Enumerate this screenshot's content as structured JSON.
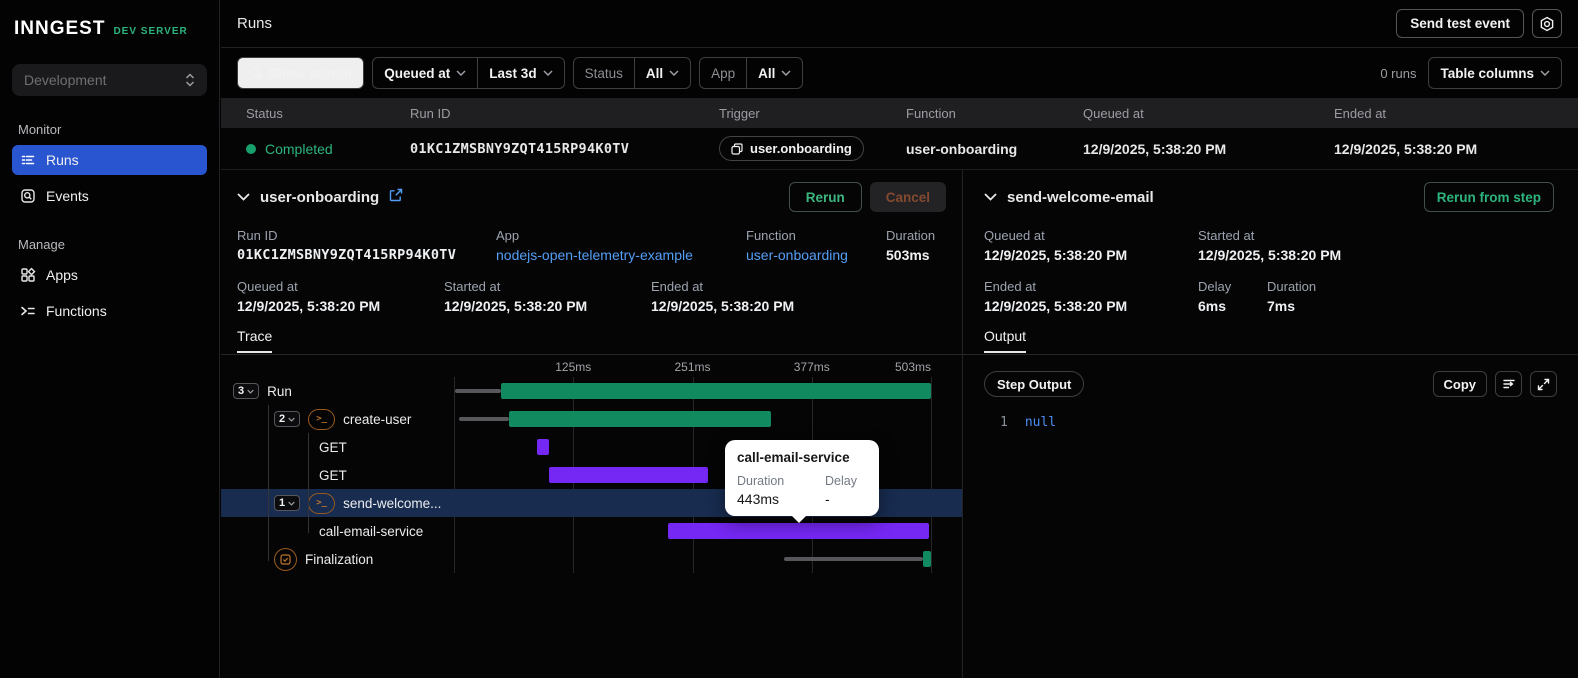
{
  "app": {
    "logo": "INNGEST",
    "env_badge": "DEV SERVER"
  },
  "sidebar": {
    "environment": "Development",
    "monitor_label": "Monitor",
    "manage_label": "Manage",
    "items": {
      "runs": "Runs",
      "events": "Events",
      "apps": "Apps",
      "functions": "Functions"
    }
  },
  "header": {
    "title": "Runs",
    "send_test_event": "Send test event"
  },
  "filters": {
    "show_search": "Show search",
    "time_field": "Queued at",
    "time_range": "Last 3d",
    "status_label": "Status",
    "status_value": "All",
    "app_label": "App",
    "app_value": "All",
    "runs_count": "0 runs",
    "table_columns": "Table columns"
  },
  "runs_table": {
    "columns": [
      "Status",
      "Run ID",
      "Trigger",
      "Function",
      "Queued at",
      "Ended at"
    ],
    "row": {
      "status": "Completed",
      "run_id": "01KC1ZMSBNY9ZQT415RP94K0TV",
      "trigger": "user.onboarding",
      "function": "user-onboarding",
      "queued_at": "12/9/2025, 5:38:20 PM",
      "ended_at": "12/9/2025, 5:38:20 PM"
    }
  },
  "run_details": {
    "title": "user-onboarding",
    "rerun": "Rerun",
    "cancel": "Cancel",
    "fields_row1": [
      {
        "label": "Run ID",
        "value": "01KC1ZMSBNY9ZQT415RP94K0TV",
        "kind": "mono"
      },
      {
        "label": "App",
        "value": "nodejs-open-telemetry-example",
        "kind": "link"
      },
      {
        "label": "Function",
        "value": "user-onboarding",
        "kind": "link"
      },
      {
        "label": "Duration",
        "value": "503ms"
      }
    ],
    "fields_row2": [
      {
        "label": "Queued at",
        "value": "12/9/2025, 5:38:20 PM"
      },
      {
        "label": "Started at",
        "value": "12/9/2025, 5:38:20 PM"
      },
      {
        "label": "Ended at",
        "value": "12/9/2025, 5:38:20 PM"
      }
    ],
    "tab": "Trace"
  },
  "trace": {
    "axis_ticks": [
      {
        "label": "125ms",
        "pct": 25
      },
      {
        "label": "251ms",
        "pct": 50
      },
      {
        "label": "377ms",
        "pct": 75
      },
      {
        "label": "503ms",
        "pct": 100
      }
    ],
    "gridlines_pct": [
      0,
      25,
      50,
      75,
      100
    ],
    "rows": [
      {
        "label": "Run",
        "badge": "3",
        "indent": 0,
        "icon": null,
        "line": [
          0.2,
          9.9
        ],
        "bar": [
          9.9,
          100
        ],
        "color": "green",
        "selected": false
      },
      {
        "label": "create-user",
        "badge": "2",
        "indent": 1,
        "icon": "code",
        "line": [
          1.0,
          11.5
        ],
        "bar": [
          11.5,
          66.5
        ],
        "color": "green",
        "selected": false
      },
      {
        "label": "GET",
        "badge": null,
        "indent": 2,
        "icon": null,
        "line": null,
        "bar": [
          17.4,
          19.9
        ],
        "color": "purple",
        "selected": false
      },
      {
        "label": "GET",
        "badge": null,
        "indent": 2,
        "icon": null,
        "line": null,
        "bar": [
          19.9,
          53.2
        ],
        "color": "purple",
        "selected": false
      },
      {
        "label": "send-welcome...",
        "badge": "1",
        "indent": 1,
        "icon": "code",
        "line": null,
        "bar": [
          67.5,
          70.6
        ],
        "color": "green",
        "selected": true
      },
      {
        "label": "call-email-service",
        "badge": null,
        "indent": 2,
        "icon": null,
        "line": null,
        "bar": [
          44.9,
          99.6
        ],
        "color": "purple",
        "selected": false
      },
      {
        "label": "Finalization",
        "badge": null,
        "indent": 1,
        "icon": "check",
        "line": [
          69.2,
          98.3
        ],
        "bar": [
          98.3,
          100
        ],
        "color": "green",
        "selected": false
      }
    ],
    "tooltip": {
      "title": "call-email-service",
      "duration_label": "Duration",
      "delay_label": "Delay",
      "duration": "443ms",
      "delay": "-"
    }
  },
  "step_details": {
    "title": "send-welcome-email",
    "rerun_from_step": "Rerun from step",
    "fields_row1": [
      {
        "label": "Queued at",
        "value": "12/9/2025, 5:38:20 PM"
      },
      {
        "label": "Started at",
        "value": "12/9/2025, 5:38:20 PM"
      }
    ],
    "fields_row2": [
      {
        "label": "Ended at",
        "value": "12/9/2025, 5:38:20 PM"
      },
      {
        "label": "Delay",
        "value": "6ms"
      },
      {
        "label": "Duration",
        "value": "7ms"
      }
    ],
    "tab": "Output",
    "output": {
      "badge": "Step Output",
      "copy": "Copy",
      "line_number": "1",
      "code": "null"
    }
  },
  "colors": {
    "green": "#108a5e",
    "purple": "#7527f3",
    "green_text": "#2db57d",
    "selected_row": "#182c50",
    "accent_blue": "#2a55d0",
    "link": "#549ef6"
  }
}
